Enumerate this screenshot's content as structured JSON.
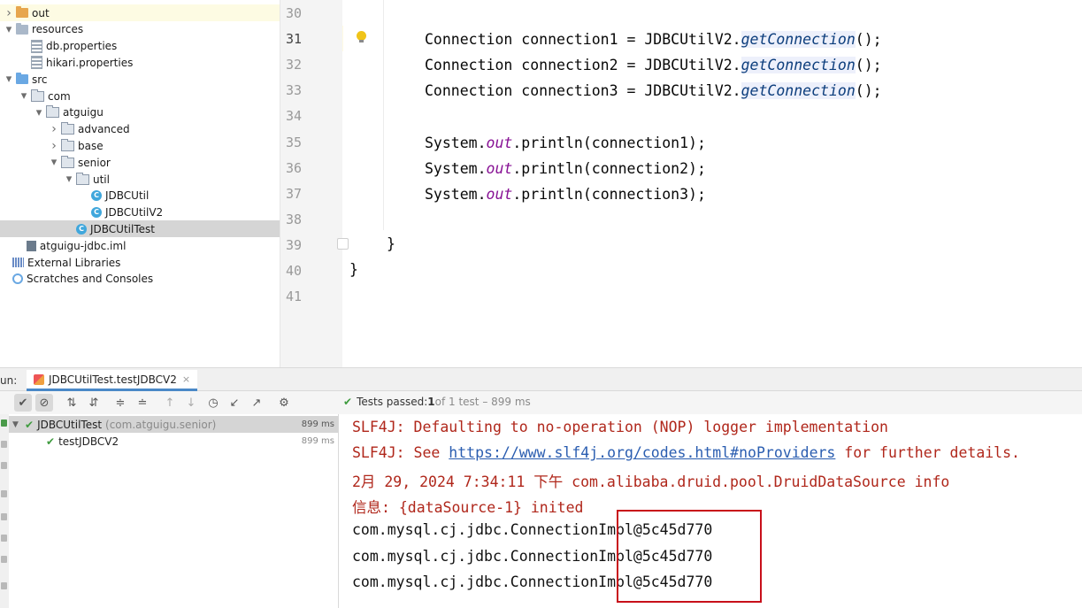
{
  "project_tree": {
    "rows": [
      {
        "label": "out",
        "depth": 0,
        "icon": "folder-orange",
        "arrow": "right",
        "highlight": true
      },
      {
        "label": "resources",
        "depth": 0,
        "icon": "folder-res",
        "arrow": "down"
      },
      {
        "label": "db.properties",
        "depth": 1,
        "icon": "properties-file"
      },
      {
        "label": "hikari.properties",
        "depth": 1,
        "icon": "properties-file"
      },
      {
        "label": "src",
        "depth": 0,
        "icon": "folder-blue",
        "arrow": "down"
      },
      {
        "label": "com",
        "depth": 1,
        "icon": "package",
        "arrow": "down"
      },
      {
        "label": "atguigu",
        "depth": 2,
        "icon": "package",
        "arrow": "down"
      },
      {
        "label": "advanced",
        "depth": 3,
        "icon": "package",
        "arrow": "right"
      },
      {
        "label": "base",
        "depth": 3,
        "icon": "package",
        "arrow": "right"
      },
      {
        "label": "senior",
        "depth": 3,
        "icon": "package",
        "arrow": "down"
      },
      {
        "label": "util",
        "depth": 4,
        "icon": "package",
        "arrow": "down"
      },
      {
        "label": "JDBCUtil",
        "depth": 5,
        "icon": "class"
      },
      {
        "label": "JDBCUtilV2",
        "depth": 5,
        "icon": "class"
      },
      {
        "label": "JDBCUtilTest",
        "depth": 4,
        "icon": "class",
        "selected": true
      },
      {
        "label": "atguigu-jdbc.iml",
        "depth": 0.7,
        "icon": "iml-file"
      },
      {
        "label": "External Libraries",
        "depth": -0.3,
        "icon": "libraries"
      },
      {
        "label": "Scratches and Consoles",
        "depth": -0.3,
        "icon": "scratches"
      }
    ]
  },
  "editor": {
    "line_numbers": [
      "30",
      "31",
      "32",
      "33",
      "34",
      "35",
      "36",
      "37",
      "38",
      "39",
      "40",
      "41"
    ],
    "current_line": "31",
    "lines": [
      {
        "ln": "31",
        "pre": "Connection connection1 = JDBCUtilV2.",
        "call": "getConnection",
        "post": "();"
      },
      {
        "ln": "32",
        "pre": "Connection connection2 = JDBCUtilV2.",
        "call": "getConnection",
        "post": "();"
      },
      {
        "ln": "33",
        "pre": "Connection connection3 = JDBCUtilV2.",
        "call": "getConnection",
        "post": "();"
      },
      {
        "ln": "35",
        "pre": "System.",
        "field": "out",
        "post": ".println(connection1);"
      },
      {
        "ln": "36",
        "pre": "System.",
        "field": "out",
        "post": ".println(connection2);"
      },
      {
        "ln": "37",
        "pre": "System.",
        "field": "out",
        "post": ".println(connection3);"
      }
    ],
    "brace_inner": "}",
    "brace_outer": "}"
  },
  "run_panel": {
    "label": "un:",
    "tab_label": "JDBCUtilTest.testJDBCV2",
    "tab_close": "×",
    "status": {
      "prefix": "Tests passed: ",
      "passed": "1",
      "rest": " of 1 test – 899 ms"
    },
    "tests": [
      {
        "name": "JDBCUtilTest",
        "detail": "(com.atguigu.senior)",
        "time": "899 ms"
      },
      {
        "name": "testJDBCV2",
        "time": "899 ms"
      }
    ]
  },
  "console": {
    "lines": [
      {
        "text": "SLF4J: Defaulting to no-operation (NOP) logger implementation",
        "color": "#b0271b"
      },
      {
        "pre": "SLF4J: See ",
        "link": "https://www.slf4j.org/codes.html#noProviders",
        "post": " for further details.",
        "color": "#b0271b"
      },
      {
        "text": "2月 29, 2024 7:34:11 下午 com.alibaba.druid.pool.DruidDataSource info",
        "color": "#b0271b"
      },
      {
        "text": "信息: {dataSource-1} inited",
        "color": "#b0271b"
      },
      {
        "text": "com.mysql.cj.jdbc.ConnectionImpl@5c45d770",
        "color": "#111111"
      },
      {
        "text": "com.mysql.cj.jdbc.ConnectionImpl@5c45d770",
        "color": "#111111"
      },
      {
        "text": "com.mysql.cj.jdbc.ConnectionImpl@5c45d770",
        "color": "#111111"
      }
    ]
  },
  "colors": {
    "accent_tab": "#4a88c7",
    "pass_green": "#3f9b3f",
    "error_red": "#b0271b",
    "annotation_box": "#c8101a"
  }
}
